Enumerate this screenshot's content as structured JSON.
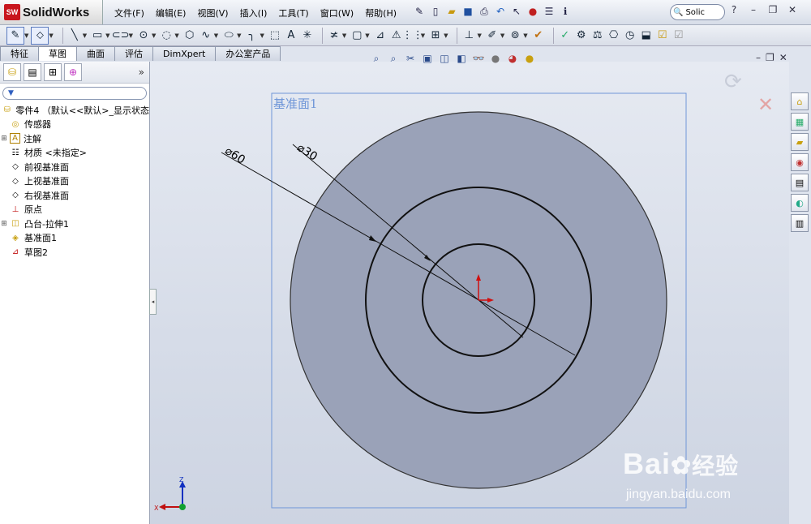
{
  "app": {
    "name": "SolidWorks",
    "logo_text": "SW"
  },
  "menu": [
    "文件(F)",
    "编辑(E)",
    "视图(V)",
    "插入(I)",
    "工具(T)",
    "窗口(W)",
    "帮助(H)"
  ],
  "search": {
    "placeholder": "Solic"
  },
  "tabs": [
    {
      "label": "特征",
      "active": false
    },
    {
      "label": "草图",
      "active": true
    },
    {
      "label": "曲面",
      "active": false
    },
    {
      "label": "评估",
      "active": false
    },
    {
      "label": "DimXpert",
      "active": false
    },
    {
      "label": "办公室产品",
      "active": false
    }
  ],
  "tree": {
    "root": "零件4 （默认<<默认>_显示状态",
    "items": [
      {
        "label": "传感器",
        "icon": "sensor-icon",
        "expandable": false
      },
      {
        "label": "注解",
        "icon": "annotation-icon",
        "expandable": true
      },
      {
        "label": "材质 <未指定>",
        "icon": "material-icon",
        "expandable": false
      },
      {
        "label": "前视基准面",
        "icon": "plane-icon",
        "expandable": false
      },
      {
        "label": "上视基准面",
        "icon": "plane-icon",
        "expandable": false
      },
      {
        "label": "右视基准面",
        "icon": "plane-icon",
        "expandable": false
      },
      {
        "label": "原点",
        "icon": "origin-icon",
        "expandable": false
      },
      {
        "label": "凸台-拉伸1",
        "icon": "extrude-icon",
        "expandable": true
      },
      {
        "label": "基准面1",
        "icon": "plane-icon",
        "expandable": false
      },
      {
        "label": "草图2",
        "icon": "sketch-icon",
        "expandable": false
      }
    ]
  },
  "viewport": {
    "plane_label": "基准面1",
    "dimensions": [
      "⌀60",
      "⌀30"
    ],
    "triad": {
      "z": "Z",
      "x": "X"
    }
  },
  "watermark": {
    "brand": "Bai",
    "brand_suffix": "经验",
    "site": "jingyan.baidu.com"
  },
  "colors": {
    "part_fill": "#9aa2b8",
    "plane_border": "#6f96d8",
    "origin": "#d01010",
    "plane_label": "#6f96d8"
  }
}
